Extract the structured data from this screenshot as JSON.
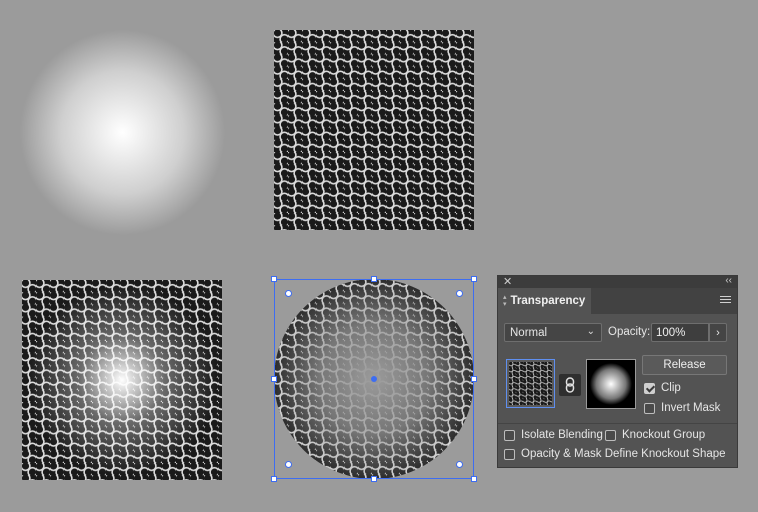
{
  "canvas": {
    "background": "#9b9b9b",
    "selection_color": "#3d6df2",
    "objects": [
      "radial-gradient-circle",
      "dot-pattern",
      "pattern-over-gradient",
      "opacity-masked-pattern"
    ]
  },
  "panel": {
    "tab_label": "Transparency",
    "blend_mode": "Normal",
    "opacity_label": "Opacity:",
    "opacity_value": "100%",
    "release_label": "Release",
    "clip_label": "Clip",
    "clip_checked": true,
    "invert_mask_label": "Invert Mask",
    "invert_mask_checked": false,
    "isolate_blending_label": "Isolate Blending",
    "isolate_blending_checked": false,
    "knockout_group_label": "Knockout Group",
    "knockout_group_checked": false,
    "opacity_mask_knockout_label": "Opacity & Mask Define Knockout Shape",
    "opacity_mask_knockout_checked": false,
    "icons": {
      "close": "close-icon",
      "collapse": "collapse-icon",
      "menu": "hamburger-menu-icon",
      "link": "chain-link-icon",
      "chevron": "chevron-down-icon",
      "arrow": "chevron-right-icon"
    }
  }
}
